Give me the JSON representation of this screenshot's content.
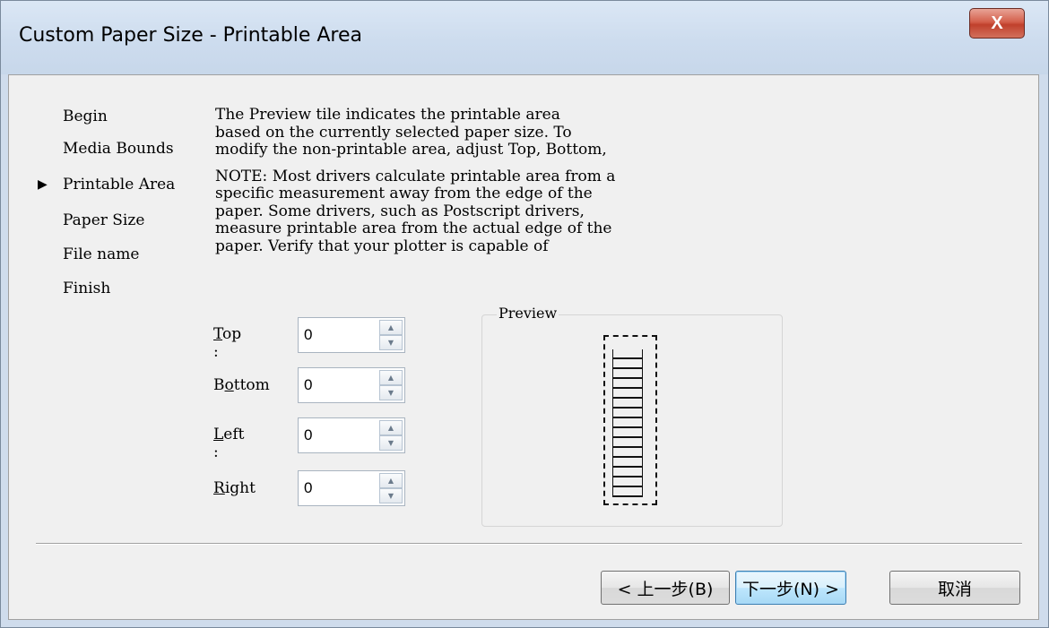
{
  "window": {
    "title": "Custom Paper Size - Printable Area",
    "close_label": "X"
  },
  "steps": {
    "items": [
      {
        "label": "Begin"
      },
      {
        "label": "Media Bounds"
      },
      {
        "label": "Printable Area"
      },
      {
        "label": "Paper Size"
      },
      {
        "label": "File name"
      },
      {
        "label": "Finish"
      }
    ],
    "current_marker": "▶"
  },
  "description": {
    "lines": [
      "The Preview tile indicates the printable area",
      "based on the currently selected paper size. To",
      "modify the non-printable area, adjust Top, Bottom,",
      "NOTE: Most drivers calculate printable area from a",
      "specific measurement away from the edge of the",
      "paper. Some drivers, such as Postscript drivers,",
      "measure printable area from the actual edge of the",
      "paper. Verify that your plotter is capable of"
    ]
  },
  "fields": [
    {
      "label_key": "T",
      "label_rest": "op :",
      "value": "0"
    },
    {
      "label_key": "o",
      "label_pre": "B",
      "label_rest": "ttom",
      "value": "0"
    },
    {
      "label_key": "L",
      "label_rest": "eft :",
      "value": "0"
    },
    {
      "label_key": "R",
      "label_rest": "ight",
      "value": "0"
    }
  ],
  "preview": {
    "label": "Preview"
  },
  "buttons": {
    "back": "< 上一步(B)",
    "next": "下一步(N) >",
    "cancel": "取消"
  }
}
